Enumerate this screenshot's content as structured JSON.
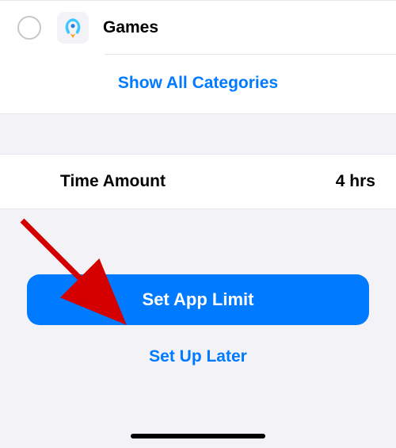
{
  "categories": {
    "items": [
      {
        "label": "Games",
        "icon": "rocket"
      }
    ],
    "show_all_label": "Show All Categories"
  },
  "time": {
    "label": "Time Amount",
    "value": "4 hrs"
  },
  "buttons": {
    "primary": "Set App Limit",
    "secondary": "Set Up Later"
  },
  "colors": {
    "accent": "#007aff"
  }
}
